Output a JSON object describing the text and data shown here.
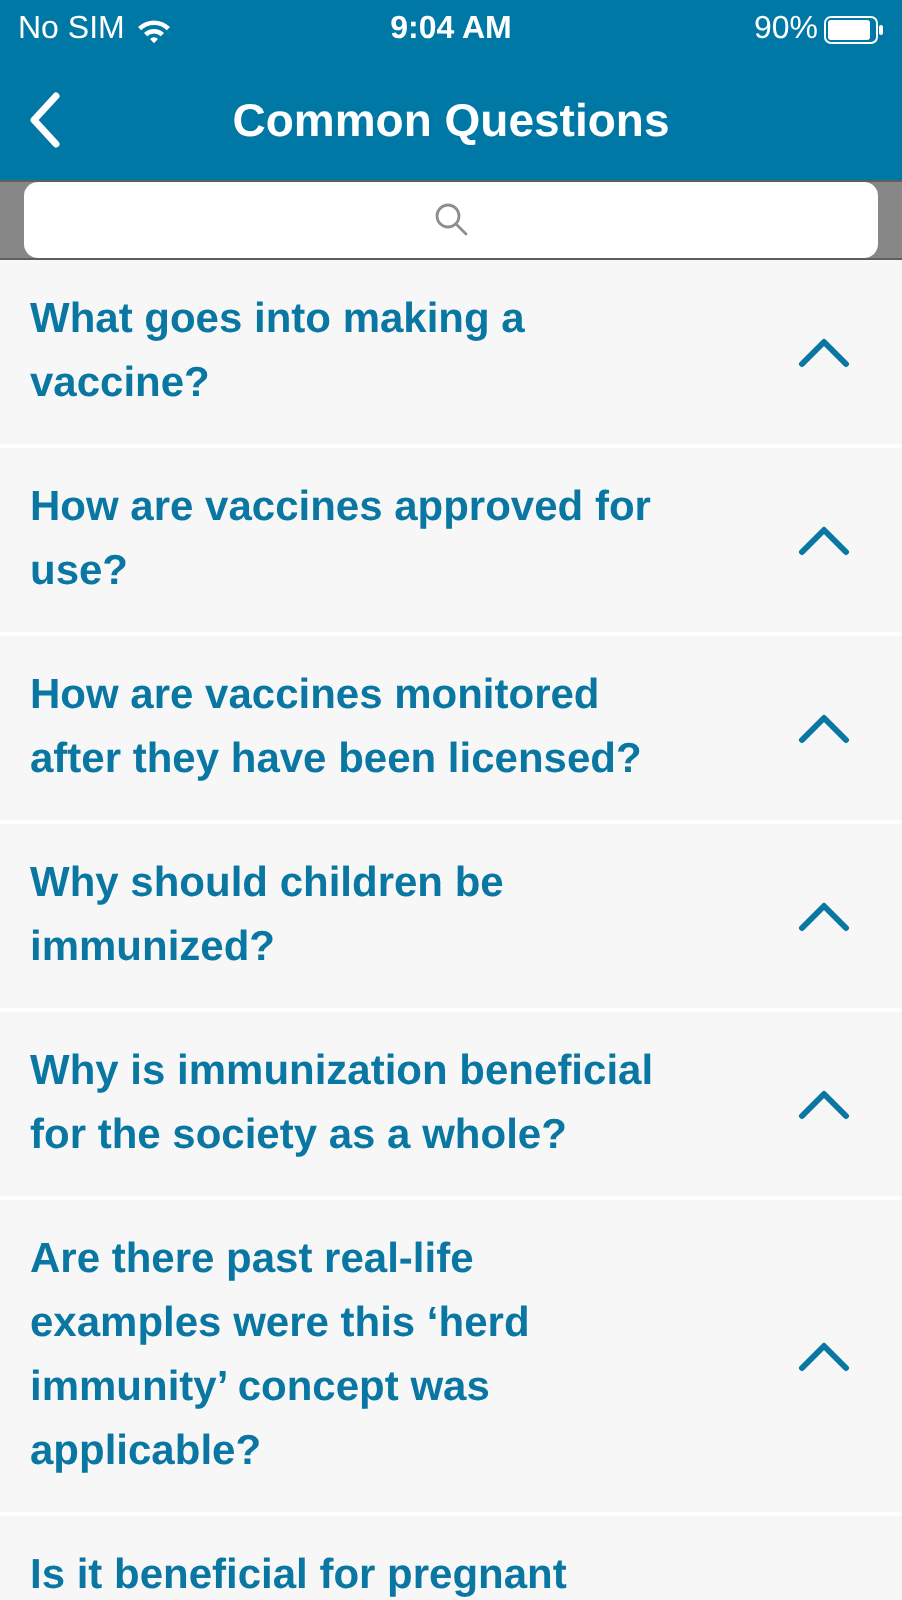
{
  "status_bar": {
    "carrier": "No SIM",
    "time": "9:04 AM",
    "battery": "90%"
  },
  "nav_bar": {
    "title": "Common Questions"
  },
  "questions": [
    {
      "text": "What goes into making a vaccine?"
    },
    {
      "text": "How are vaccines approved for use?"
    },
    {
      "text": "How are vaccines monitored after they have been licensed?"
    },
    {
      "text": "Why should children be immunized?"
    },
    {
      "text": "Why is immunization beneficial for the society as a whole?"
    },
    {
      "text": "Are there past real-life examples were this ‘herd immunity’ concept was applicable?"
    },
    {
      "text": "Is it beneficial for pregnant"
    }
  ]
}
